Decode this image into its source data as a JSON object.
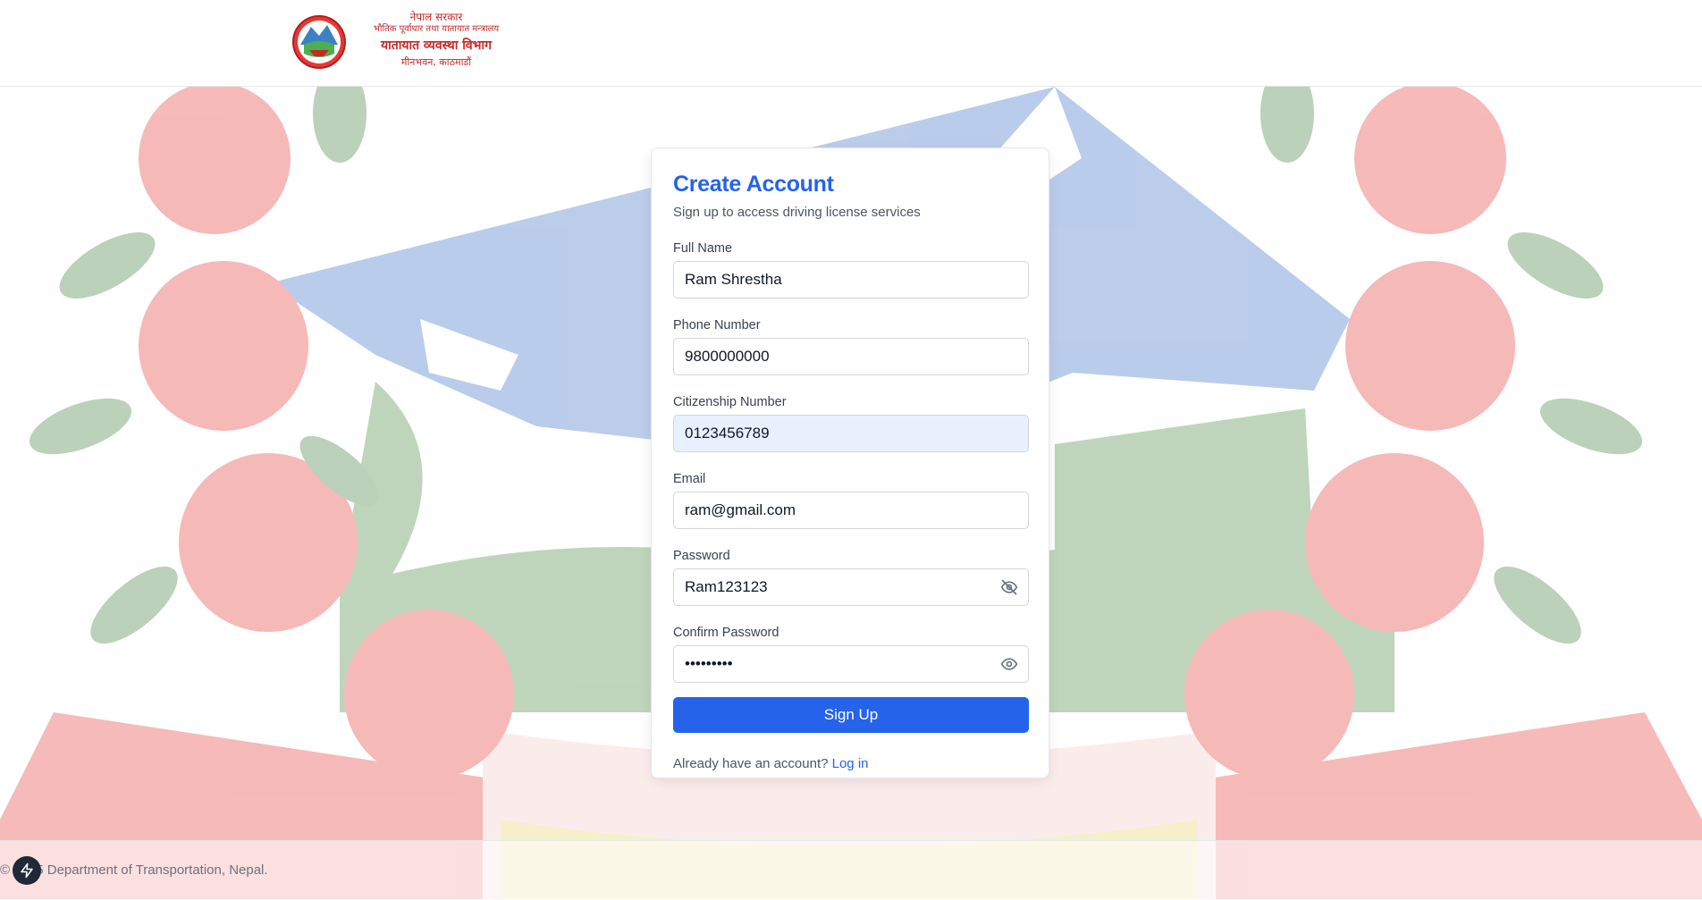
{
  "header": {
    "gov_line": "नेपाल सरकार",
    "ministry_line": "भौतिक पूर्वाधार तथा यातायात मन्त्रालय",
    "department_line": "यातायात व्यवस्था विभाग",
    "location_line": "मीनभवन, काठमाडौं"
  },
  "form": {
    "title": "Create Account",
    "subtitle": "Sign up to access driving license services",
    "fields": {
      "full_name": {
        "label": "Full Name",
        "value": "Ram Shrestha"
      },
      "phone": {
        "label": "Phone Number",
        "value": "9800000000"
      },
      "citizenship": {
        "label": "Citizenship Number",
        "value": "0123456789"
      },
      "email": {
        "label": "Email",
        "value": "ram@gmail.com"
      },
      "password": {
        "label": "Password",
        "value": "Ram123123",
        "toggle_icon": "eye-off-icon"
      },
      "confirm_password": {
        "label": "Confirm Password",
        "value": "Ram123123",
        "toggle_icon": "eye-icon"
      }
    },
    "submit_label": "Sign Up",
    "login_prompt": "Already have an account?",
    "login_link": "Log in"
  },
  "footer": {
    "copyright": "© 2025 Department of Transportation, Nepal.",
    "badge_icon": "lightning-icon"
  },
  "colors": {
    "accent": "#2563eb",
    "brand_red": "#c62828",
    "autofill_bg": "#e8f0fe"
  }
}
